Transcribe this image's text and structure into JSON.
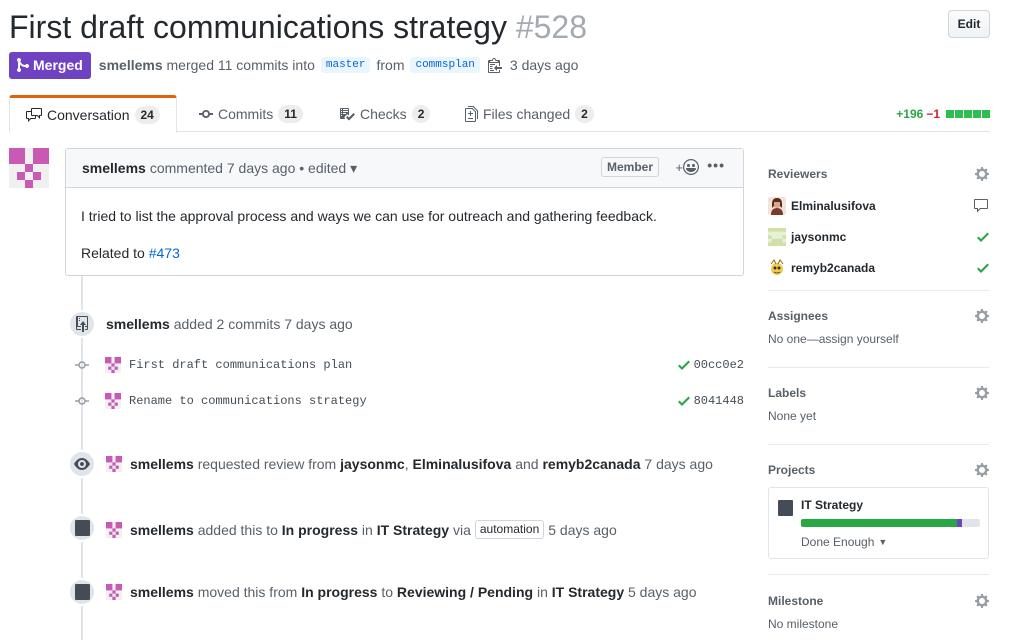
{
  "header": {
    "title": "First draft communications strategy",
    "number": "#528",
    "edit_label": "Edit"
  },
  "meta": {
    "state": "Merged",
    "author": "smellems",
    "action": "merged 11 commits into",
    "base_branch": "master",
    "from": "from",
    "head_branch": "commsplan",
    "when": "3 days ago"
  },
  "tabs": [
    {
      "label": "Conversation",
      "count": "24"
    },
    {
      "label": "Commits",
      "count": "11"
    },
    {
      "label": "Checks",
      "count": "2"
    },
    {
      "label": "Files changed",
      "count": "2"
    }
  ],
  "diffstat": {
    "additions": "+196",
    "deletions": "−1",
    "colors": [
      "#2cbe4e",
      "#2cbe4e",
      "#2cbe4e",
      "#2cbe4e",
      "#2cbe4e"
    ]
  },
  "comment": {
    "author": "smellems",
    "action": "commented",
    "when": "7 days ago",
    "edited": "• edited ▾",
    "badge": "Member",
    "react": "+",
    "more": "•••",
    "body1": "I tried to list the approval process and ways we can use for outreach and gathering feedback.",
    "related_label": "Related to",
    "related_link": "#473"
  },
  "events": {
    "commits_added": {
      "author": "smellems",
      "text": "added 2 commits",
      "when": "7 days ago"
    },
    "commits": [
      {
        "message": "First draft communications plan",
        "sha": "00cc0e2"
      },
      {
        "message": "Rename to communications strategy",
        "sha": "8041448"
      }
    ],
    "review_request": {
      "author": "smellems",
      "text1": "requested review from",
      "r1": "jaysonmc",
      "sep": ",",
      "r2": "Elminalusifova",
      "and": "and",
      "r3": "remyb2canada",
      "when": "7 days ago"
    },
    "added_project": {
      "author": "smellems",
      "text1": "added this to",
      "column": "In progress",
      "in": "in",
      "project": "IT Strategy",
      "via": "via",
      "chip": "automation",
      "when": "5 days ago"
    },
    "moved_project": {
      "author": "smellems",
      "text1": "moved this from",
      "from_col": "In progress",
      "to": "to",
      "to_col": "Reviewing / Pending",
      "in": "in",
      "project": "IT Strategy",
      "when": "5 days ago"
    }
  },
  "sidebar": {
    "reviewers": {
      "title": "Reviewers",
      "items": [
        {
          "name": "Elminalusifova",
          "status": "comment-icon"
        },
        {
          "name": "jaysonmc",
          "status": "check-icon"
        },
        {
          "name": "remyb2canada",
          "status": "check-icon"
        }
      ]
    },
    "assignees": {
      "title": "Assignees",
      "value": "No one—assign yourself"
    },
    "labels": {
      "title": "Labels",
      "value": "None yet"
    },
    "projects": {
      "title": "Projects",
      "project": "IT Strategy",
      "column": "Done Enough",
      "progress_done": 0.87,
      "progress_review": 0.03
    },
    "milestone": {
      "title": "Milestone",
      "value": "No milestone"
    }
  }
}
